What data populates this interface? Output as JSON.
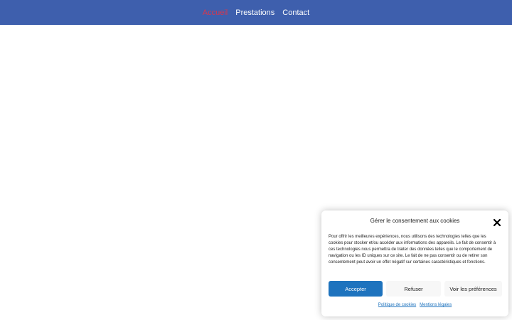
{
  "colors": {
    "nav_bg": "#3e5fad",
    "nav_active": "#d9364d",
    "accept_bg": "#1e73be",
    "link": "#1e73be"
  },
  "nav": {
    "items": [
      {
        "label": "Accueil",
        "active": true
      },
      {
        "label": "Prestations",
        "active": false
      },
      {
        "label": "Contact",
        "active": false
      }
    ]
  },
  "cookie_banner": {
    "title": "Gérer le consentement aux cookies",
    "close_icon": "close-icon",
    "message": "Pour offrir les meilleures expériences, nous utilisons des technologies telles que les cookies pour stocker et/ou accéder aux informations des appareils. Le fait de consentir à ces technologies nous permettra de traiter des données telles que le comportement de navigation ou les ID uniques sur ce site. Le fait de ne pas consentir ou de retirer son consentement peut avoir un effet négatif sur certaines caractéristiques et fonctions.",
    "accept_label": "Accepter",
    "deny_label": "Refuser",
    "prefs_label": "Voir les préférences",
    "links": {
      "cookie_policy": "Politique de cookies",
      "legal": "Mentions légales"
    }
  }
}
